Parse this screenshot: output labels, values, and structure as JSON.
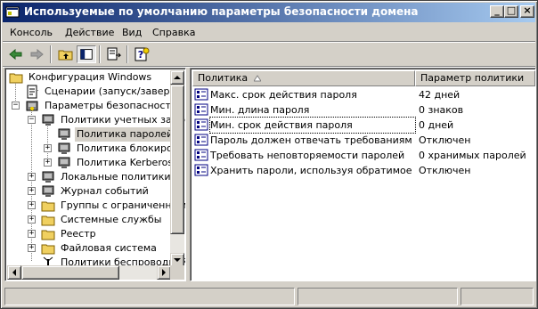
{
  "window": {
    "title": "Используемые по умолчанию параметры безопасности домена",
    "buttons": {
      "minimize": "_",
      "maximize": "□",
      "close": "×"
    }
  },
  "menu": [
    "Консоль",
    "Действие",
    "Вид",
    "Справка"
  ],
  "toolbar": {
    "icons": [
      "back-arrow-icon",
      "forward-arrow-icon",
      "up-folder-icon",
      "show-hide-tree-icon",
      "export-list-icon",
      "help-icon"
    ]
  },
  "tree": {
    "items": [
      {
        "label": "Конфигурация Windows"
      },
      {
        "label": "Сценарии (запуск/завершен"
      },
      {
        "label": "Параметры безопасности"
      },
      {
        "label": "Политики учетных запис"
      },
      {
        "label": "Политика паролей"
      },
      {
        "label": "Политика блокировк"
      },
      {
        "label": "Политика Kerberos"
      },
      {
        "label": "Локальные политики"
      },
      {
        "label": "Журнал событий"
      },
      {
        "label": "Группы с ограниченным"
      },
      {
        "label": "Системные службы"
      },
      {
        "label": "Реестр"
      },
      {
        "label": "Файловая система"
      },
      {
        "label": "Политики беспроводной"
      }
    ],
    "expander_plus": "+",
    "expander_minus": "−"
  },
  "list": {
    "columns": [
      "Политика",
      "Параметр политики"
    ],
    "rows": [
      {
        "policy": "Макс. срок действия пароля",
        "value": "42 дней"
      },
      {
        "policy": "Мин. длина пароля",
        "value": "0 знаков"
      },
      {
        "policy": "Мин. срок действия пароля",
        "value": "0 дней"
      },
      {
        "policy": "Пароль должен отвечать требованиям сл...",
        "value": "Отключен"
      },
      {
        "policy": "Требовать неповторяемости паролей",
        "value": "0 хранимых паролей"
      },
      {
        "policy": "Хранить пароли, используя обратимое ши...",
        "value": "Отключен"
      }
    ]
  },
  "colors": {
    "titlebar_start": "#0a246a",
    "titlebar_end": "#a6caf0",
    "face": "#d4d0c8"
  }
}
